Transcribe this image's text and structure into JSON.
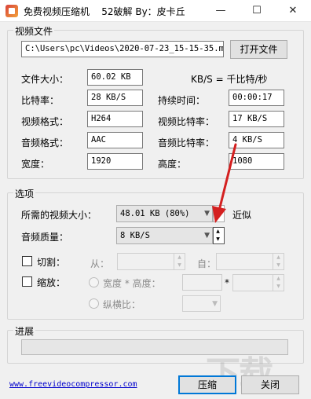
{
  "window": {
    "title": "免费视频压缩机    52破解 By：皮卡丘",
    "minimize": "—",
    "maximize": "☐",
    "close": "✕"
  },
  "video_file": {
    "group_title": "视频文件",
    "path": "C:\\Users\\pc\\Videos\\2020-07-23_15-15-35.mp4",
    "open_button": "打开文件"
  },
  "info": {
    "file_size_label": "文件大小：",
    "file_size": "60.02 KB",
    "unit_note": "KB/S = 千比特/秒",
    "bitrate_label": "比特率：",
    "bitrate": "28 KB/S",
    "duration_label": "持续时间：",
    "duration": "00:00:17",
    "video_format_label": "视频格式：",
    "video_format": "H264",
    "video_bitrate_label": "视频比特率：",
    "video_bitrate": "17 KB/S",
    "audio_format_label": "音频格式：",
    "audio_format": "AAC",
    "audio_bitrate_label": "音频比特率：",
    "audio_bitrate": "4 KB/S",
    "width_label": "宽度：",
    "width": "1920",
    "height_label": "高度：",
    "height": "1080"
  },
  "options": {
    "group_title": "选项",
    "target_size_label": "所需的视频大小：",
    "target_size": "48.01 KB (80%)",
    "approx_label": "近似",
    "audio_quality_label": "音频质量：",
    "audio_quality": "8 KB/S",
    "cut_label": "切割：",
    "from_label": "从：",
    "to_label": "自：",
    "scale_label": "缩放：",
    "wh_label": "宽度 * 高度：",
    "times": "*",
    "aspect_label": "纵横比："
  },
  "progress": {
    "group_title": "进展",
    "value": 0
  },
  "footer": {
    "website": "www.freevideocompressor.com",
    "compress_button": "压缩",
    "close_button": "关闭"
  },
  "colors": {
    "arrow": "#d42020",
    "link": "#0000cc",
    "focus": "#0078d7"
  }
}
